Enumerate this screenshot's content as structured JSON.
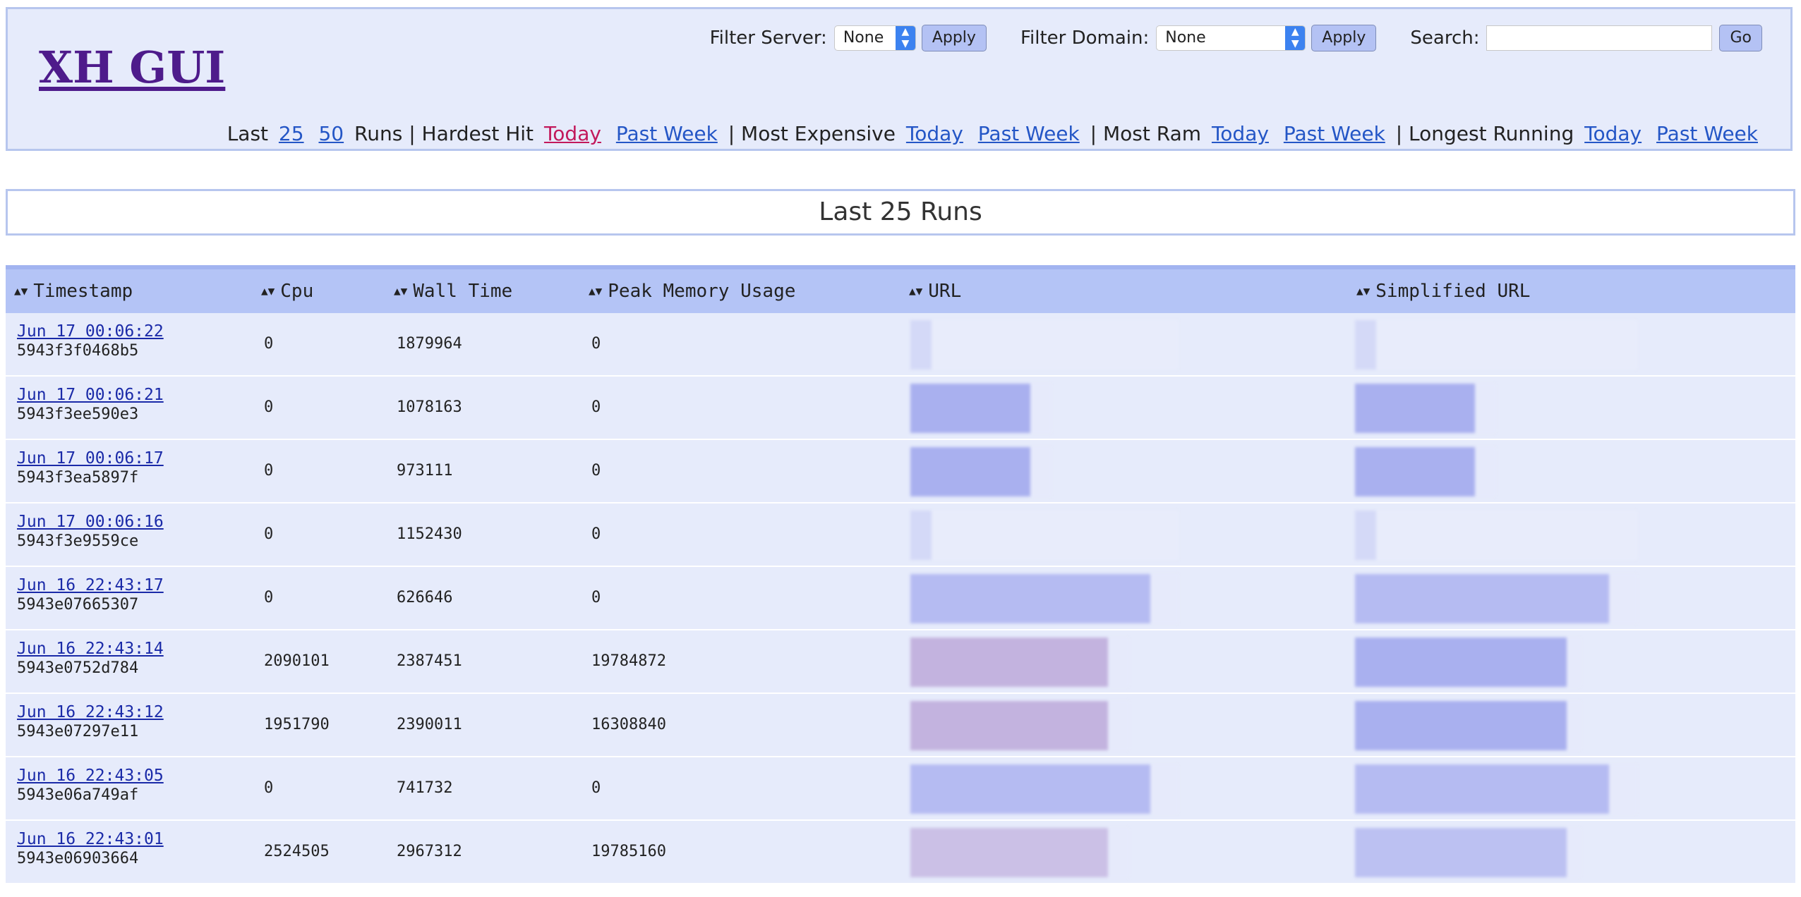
{
  "header": {
    "logo": "XH GUI",
    "filter_server_label": "Filter Server:",
    "filter_server_value": "None",
    "filter_domain_label": "Filter Domain:",
    "filter_domain_value": "None",
    "apply_label": "Apply",
    "search_label": "Search:",
    "go_label": "Go",
    "search_value": ""
  },
  "nav": {
    "last": "Last",
    "n25": "25",
    "n50": "50",
    "runs": "Runs | Hardest Hit",
    "today": "Today",
    "past_week": "Past Week",
    "most_expensive": "| Most Expensive",
    "most_ram": "| Most Ram",
    "longest_running": "| Longest Running"
  },
  "page_title": "Last 25 Runs",
  "table": {
    "columns": [
      "Timestamp",
      "Cpu",
      "Wall Time",
      "Peak Memory Usage",
      "URL",
      "Simplified URL"
    ],
    "rows": [
      {
        "date": "Jun 17 00:06:22",
        "id": "5943f3f0468b5",
        "cpu": "0",
        "wall": "1879964",
        "mem": "0"
      },
      {
        "date": "Jun 17 00:06:21",
        "id": "5943f3ee590e3",
        "cpu": "0",
        "wall": "1078163",
        "mem": "0"
      },
      {
        "date": "Jun 17 00:06:17",
        "id": "5943f3ea5897f",
        "cpu": "0",
        "wall": "973111",
        "mem": "0"
      },
      {
        "date": "Jun 17 00:06:16",
        "id": "5943f3e9559ce",
        "cpu": "0",
        "wall": "1152430",
        "mem": "0"
      },
      {
        "date": "Jun 16 22:43:17",
        "id": "5943e07665307",
        "cpu": "0",
        "wall": "626646",
        "mem": "0"
      },
      {
        "date": "Jun 16 22:43:14",
        "id": "5943e0752d784",
        "cpu": "2090101",
        "wall": "2387451",
        "mem": "19784872"
      },
      {
        "date": "Jun 16 22:43:12",
        "id": "5943e07297e11",
        "cpu": "1951790",
        "wall": "2390011",
        "mem": "16308840"
      },
      {
        "date": "Jun 16 22:43:05",
        "id": "5943e06a749af",
        "cpu": "0",
        "wall": "741732",
        "mem": "0"
      },
      {
        "date": "Jun 16 22:43:01",
        "id": "5943e06903664",
        "cpu": "2524505",
        "wall": "2967312",
        "mem": "19785160"
      }
    ]
  },
  "colors": {
    "accent": "#b4c4f6",
    "row_bg": "#e6ebfb",
    "link": "#2456c6",
    "active_link": "#c2185b",
    "logo": "#4e1b8b"
  }
}
